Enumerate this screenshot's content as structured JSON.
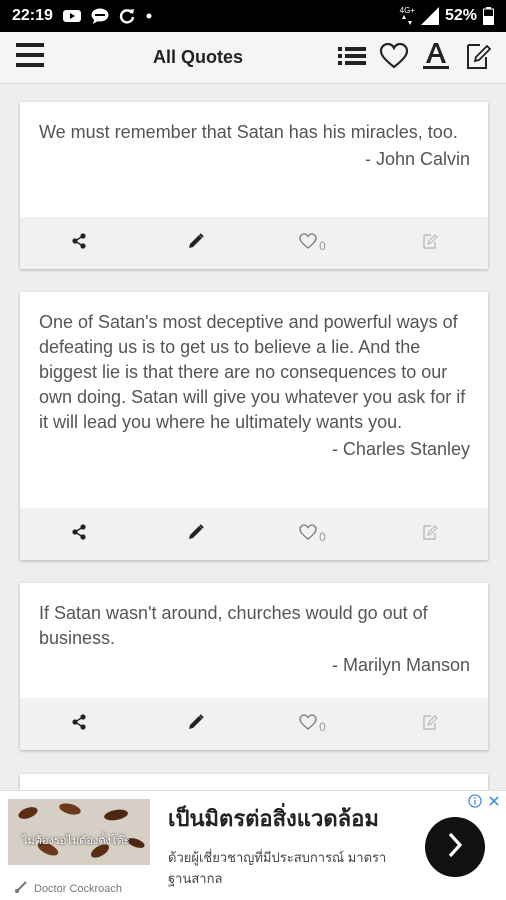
{
  "status_bar": {
    "time": "22:19",
    "network_label": "4G+",
    "battery": "52%"
  },
  "app_bar": {
    "title": "All Quotes"
  },
  "quotes": [
    {
      "text": "We must remember that Satan has his miracles, too.",
      "author": "- John Calvin",
      "likes": "0"
    },
    {
      "text": "One of Satan's most deceptive and powerful ways of defeating us is to get us to believe a lie. And the biggest lie is that there are no consequences to our own doing. Satan will give you whatever you ask for if it will lead you where he ultimately wants you.",
      "author": "- Charles Stanley",
      "likes": "0"
    },
    {
      "text": "If Satan wasn't around, churches would go out of business.",
      "author": "- Marilyn Manson",
      "likes": "0"
    }
  ],
  "ad": {
    "headline": "เป็นมิตรต่อสิ่งแวดล้อม",
    "body": "ด้วยผู้เชี่ยวชาญที่มีประสบการณ์ มาตราฐานสากล",
    "image_text": "ไม่ต้องรอไม่ต้องตั้งโต๊ะ",
    "brand": "Doctor Cockroach"
  },
  "colors": {
    "app_bar_bg": "#f5f5f5",
    "card_action_bg": "#f1f1f1",
    "text": "#555555"
  }
}
